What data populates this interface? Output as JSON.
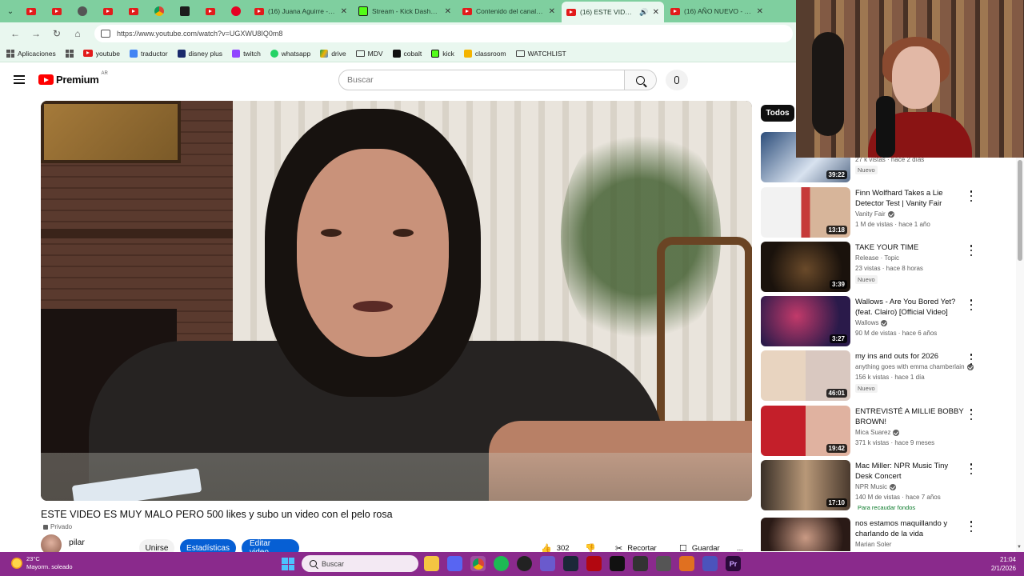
{
  "browser": {
    "tabs": [
      {
        "title": "(16) Juana Aguirre - anc",
        "icon": "youtube-favicon"
      },
      {
        "title": "Stream - Kick Dashboar",
        "icon": "kick-favicon"
      },
      {
        "title": "Contenido del canal - Yo",
        "icon": "youtube-favicon"
      },
      {
        "title": "(16) ESTE VIDEO ES",
        "icon": "youtube-favicon",
        "active": true
      },
      {
        "title": "(16) AÑO NUEVO - You",
        "icon": "youtube-favicon"
      }
    ],
    "url": "https://www.youtube.com/watch?v=UGXWU8IQ0m8",
    "bookmarks": [
      {
        "label": "Aplicaciones",
        "icon": "apps-icon"
      },
      {
        "label": "youtube",
        "icon": "youtube-icon"
      },
      {
        "label": "traductor",
        "icon": "translate-icon"
      },
      {
        "label": "disney plus",
        "icon": "disney-icon"
      },
      {
        "label": "twitch",
        "icon": "twitch-icon"
      },
      {
        "label": "whatsapp",
        "icon": "whatsapp-icon"
      },
      {
        "label": "drive",
        "icon": "drive-icon"
      },
      {
        "label": "MDV",
        "icon": "folder-icon"
      },
      {
        "label": "cobalt",
        "icon": "cobalt-icon"
      },
      {
        "label": "kick",
        "icon": "kick-icon"
      },
      {
        "label": "classroom",
        "icon": "classroom-icon"
      },
      {
        "label": "WATCHLIST",
        "icon": "folder-icon"
      }
    ]
  },
  "youtube": {
    "logo_word": "Premium",
    "logo_country": "AR",
    "search_placeholder": "Buscar",
    "video": {
      "title": "ESTE VIDEO ES MUY MALO PERO 500 likes y subo un video con el pelo rosa",
      "privacy": "Privado",
      "channel": "pilar",
      "buttons": {
        "join": "Unirse",
        "stats": "Estadísticas",
        "edit": "Editar video",
        "likes": "302",
        "clip": "Recortar",
        "save": "Guardar",
        "more": "..."
      }
    },
    "sidebar": {
      "chip": "Todos",
      "first_partial": {
        "meta": "27 k vistas · hace 2 días",
        "badge": "Nuevo",
        "duration": "39:22"
      },
      "recommendations": [
        {
          "title": "Finn Wolfhard Takes a Lie Detector Test | Vanity Fair",
          "channel": "Vanity Fair",
          "verified": true,
          "meta": "1 M de vistas · hace 1 año",
          "duration": "13:18",
          "badge": ""
        },
        {
          "title": "TAKE YOUR TIME",
          "channel": "Release · Topic",
          "verified": false,
          "meta": "23 vistas · hace 8 horas",
          "duration": "3:39",
          "badge": "Nuevo"
        },
        {
          "title": "Wallows - Are You Bored Yet? (feat. Clairo) [Official Video]",
          "channel": "Wallows",
          "verified": true,
          "meta": "90 M de vistas · hace 6 años",
          "duration": "3:27",
          "badge": ""
        },
        {
          "title": "my ins and outs for 2026",
          "channel": "anything goes with emma chamberlain",
          "verified": true,
          "meta": "156 k vistas · hace 1 día",
          "duration": "46:01",
          "badge": "Nuevo"
        },
        {
          "title": "ENTREVISTÉ A MILLIE BOBBY BROWN!",
          "channel": "Mica Suarez",
          "verified": true,
          "meta": "371 k vistas · hace 9 meses",
          "duration": "19:42",
          "badge": ""
        },
        {
          "title": "Mac Miller: NPR Music Tiny Desk Concert",
          "channel": "NPR Music",
          "verified": true,
          "meta": "140 M de vistas · hace 7 años",
          "duration": "17:10",
          "badge": "Para recaudar fondos"
        },
        {
          "title": "nos estamos maquillando y charlando de la vida",
          "channel": "Marian Soler",
          "verified": false,
          "meta": "",
          "duration": "",
          "badge": ""
        }
      ]
    }
  },
  "taskbar": {
    "weather_temp": "23°C",
    "weather_desc": "Mayorm. soleado",
    "search_placeholder": "Buscar",
    "time": "21:04",
    "date": "2/1/2026"
  },
  "colors": {
    "browser_frame": "#7fcf9f",
    "youtube_red": "#ff0000",
    "yt_blue": "#065fd4",
    "taskbar": "#8a2a8c"
  }
}
